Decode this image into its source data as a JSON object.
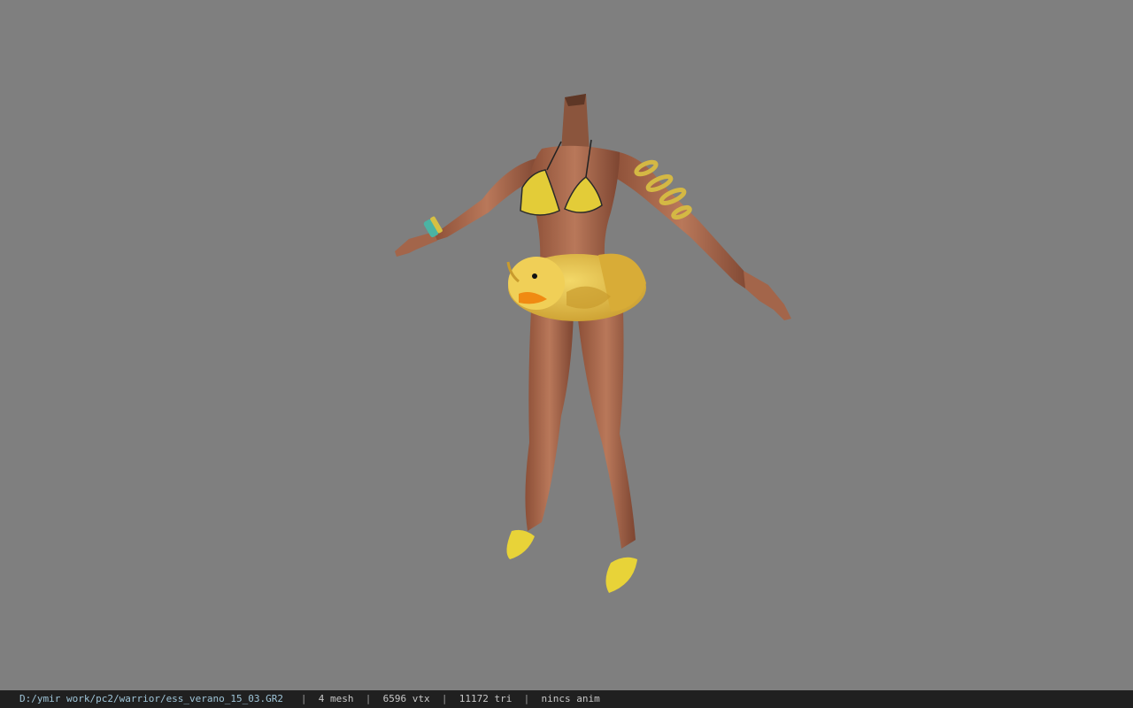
{
  "status_bar": {
    "file_path": "D:/ymir work/pc2/warrior/ess_verano_15_03.GR2",
    "mesh_count": "4 mesh",
    "vertex_count": "6596 vtx",
    "triangle_count": "11172 tri",
    "animation": "nincs anim",
    "separator": "|"
  },
  "viewport": {
    "background_color": "#7f7f7f",
    "model_description_icon": "character-model-icon",
    "colors": {
      "skin": "#a9674a",
      "bikini": "#e3cc38",
      "duck": "#e7c64b",
      "beak": "#f08a12",
      "shoes": "#e8d338",
      "bracelet": "#4bb3a3"
    }
  }
}
